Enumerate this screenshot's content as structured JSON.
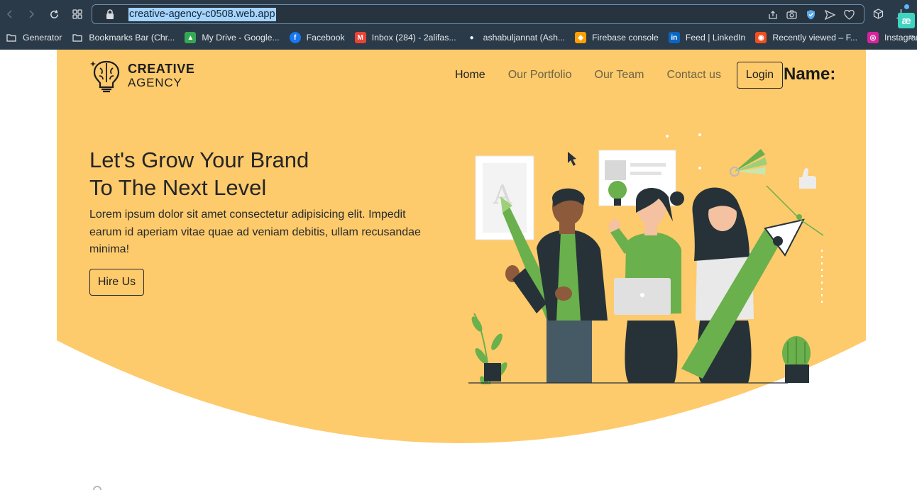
{
  "browser": {
    "url": "creative-agency-c0508.web.app",
    "bookmarks": [
      {
        "label": "Generator",
        "icon": "folder-icon",
        "color": "#e4e8ec"
      },
      {
        "label": "Bookmarks Bar (Chr...",
        "icon": "folder-icon",
        "color": "#e4e8ec"
      },
      {
        "label": "My Drive - Google...",
        "icon": "google-drive-icon",
        "color": "#34a853"
      },
      {
        "label": "Facebook",
        "icon": "facebook-icon",
        "color": "#1877f2"
      },
      {
        "label": "Inbox (284) - 2alifas...",
        "icon": "gmail-icon",
        "color": "#ea4335"
      },
      {
        "label": "ashabuljannat (Ash...",
        "icon": "github-icon",
        "color": "#ffffff"
      },
      {
        "label": "Firebase console",
        "icon": "firebase-icon",
        "color": "#ffa000"
      },
      {
        "label": "Feed | LinkedIn",
        "icon": "linkedin-icon",
        "color": "#0a66c2"
      },
      {
        "label": "Recently viewed – F...",
        "icon": "figma-icon",
        "color": "#f24e1e"
      },
      {
        "label": "Instagram",
        "icon": "instagram-icon",
        "color": "#d6249f"
      }
    ],
    "more": "»"
  },
  "site": {
    "logo": {
      "line1": "CREATIVE",
      "line2": "AGENCY"
    },
    "nav": [
      {
        "label": "Home",
        "active": true
      },
      {
        "label": "Our Portfolio",
        "active": false
      },
      {
        "label": "Our Team",
        "active": false
      },
      {
        "label": "Contact us",
        "active": false
      }
    ],
    "login_label": "Login",
    "name_label": "Name:",
    "hero": {
      "title_line1": "Let's Grow Your Brand",
      "title_line2": "To The Next Level",
      "description": "Lorem ipsum dolor sit amet consectetur adipisicing elit. Impedit earum id aperiam vitae quae ad veniam debitis, ullam recusandae minima!",
      "cta_label": "Hire Us"
    },
    "colors": {
      "hero_bg": "#fdca6c",
      "accent_green": "#6ab04c",
      "dark": "#263238"
    }
  },
  "extension": {
    "label": "æ",
    "color": "#3fd4c1"
  }
}
